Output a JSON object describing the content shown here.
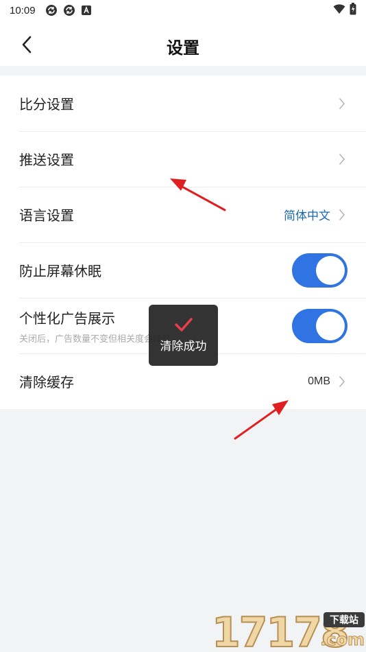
{
  "status_bar": {
    "time": "10:09",
    "icons": [
      "sync-icon",
      "sync-icon",
      "font-a-icon"
    ],
    "right_icons": [
      "wifi-icon",
      "battery-charging-icon"
    ]
  },
  "header": {
    "title": "设置",
    "back_icon": "chevron-left-icon"
  },
  "settings": {
    "score": {
      "label": "比分设置"
    },
    "push": {
      "label": "推送设置"
    },
    "language": {
      "label": "语言设置",
      "value": "简体中文"
    },
    "prevent_sleep": {
      "label": "防止屏幕休眠",
      "enabled": true
    },
    "personalized_ads": {
      "label": "个性化广告展示",
      "sub": "关闭后，广告数量不变但相关度会降低",
      "enabled": true
    },
    "clear_cache": {
      "label": "清除缓存",
      "value": "0MB"
    }
  },
  "toast": {
    "message": "清除成功",
    "icon": "check-icon"
  },
  "watermark": {
    "number": "17178",
    "badge": "下载站",
    "domain": ".com"
  },
  "colors": {
    "accent": "#2f74e2",
    "link": "#1a67b5",
    "annotation_arrow": "#e02020",
    "toast_check": "#e8404a"
  }
}
